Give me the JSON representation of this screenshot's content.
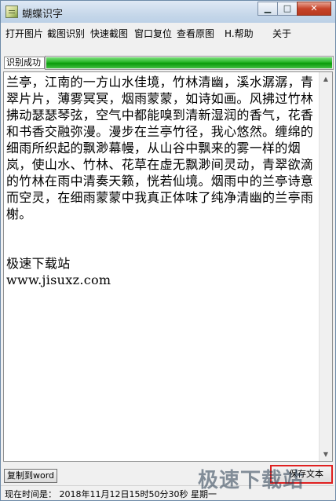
{
  "window": {
    "title": "蝴蝶识字"
  },
  "titlebar_buttons": {
    "minimize": "▁",
    "maximize": "□",
    "close": "✕"
  },
  "menu": [
    "打开图片",
    "截图识别",
    "快速截图",
    "窗口复位",
    "查看原图",
    "H.帮助",
    "关于"
  ],
  "status": {
    "label": "识别成功",
    "progress": 1.0,
    "progress_color": "#22b022"
  },
  "text_area": {
    "paragraph": "兰亭，江南的一方山水佳境，竹林清幽，溪水潺潺，青翠片片，薄雾冥冥，烟雨蒙蒙，如诗如画。风拂过竹林拂动瑟瑟琴弦，空气中都能嗅到清新湿润的香气，花香和书香交融弥漫。漫步在兰亭竹径，我心悠然。缠绵的细雨所织起的飘渺幕幔，从山谷中飘来的雾一样的烟岚，使山水、竹林、花草在虚无飘渺间灵动，青翠欲滴的竹林在雨中清奏天籁，恍若仙境。烟雨中的兰亭诗意而空灵，在细雨蒙蒙中我真正体味了纯净清幽的兰亭雨榭。",
    "site_name": "极速下载站",
    "site_url": "www.jisuxz.com"
  },
  "buttons": {
    "copy_word": "复制到word",
    "save_text": "保存文本"
  },
  "statusbar": {
    "time": "现在时间是： 2018年11月12日15时50分30秒 星期一"
  },
  "watermark": "极速下载站",
  "colors": {
    "highlight": "#e02020"
  }
}
